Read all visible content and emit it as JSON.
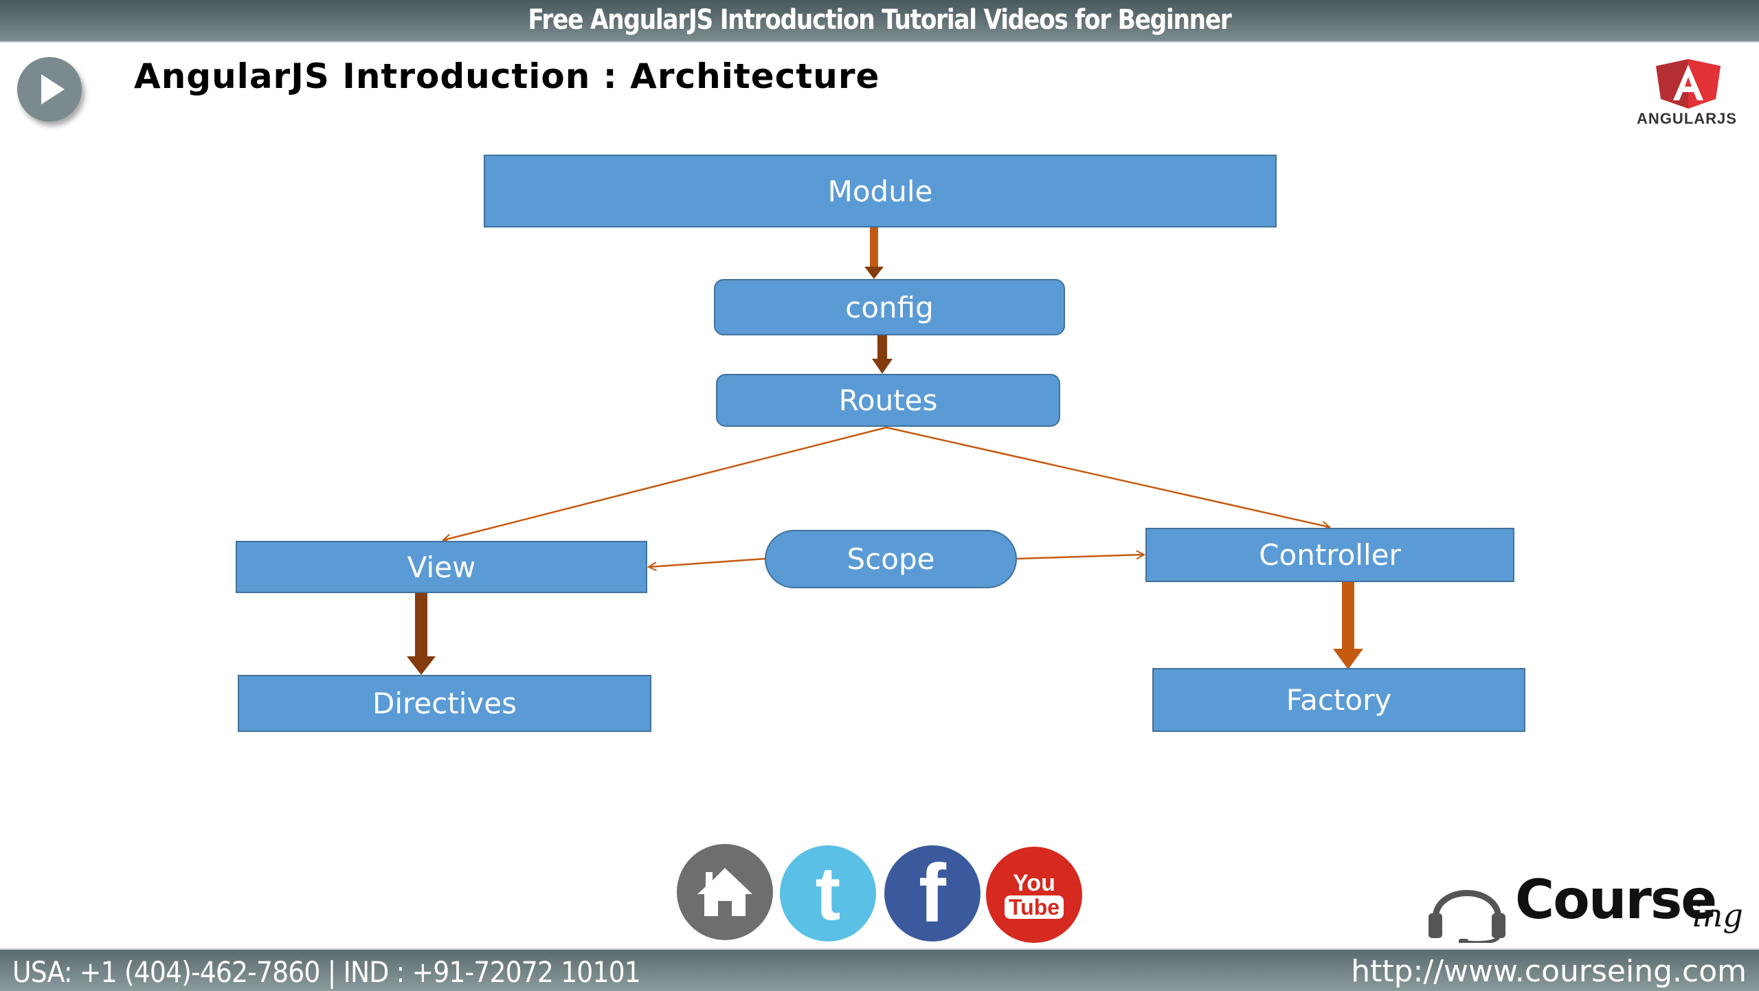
{
  "header": {
    "banner_title": "Free AngularJS Introduction Tutorial Videos for Beginner",
    "slide_title": "AngularJS Introduction : Architecture",
    "play_icon": "play-icon",
    "logo_text": "ANGULARJS",
    "logo_letter": "A"
  },
  "diagram": {
    "nodes": {
      "module": "Module",
      "config": "config",
      "routes": "Routes",
      "view": "View",
      "scope": "Scope",
      "controller": "Controller",
      "directives": "Directives",
      "factory": "Factory"
    },
    "edges": [
      {
        "from": "Module",
        "to": "config",
        "style": "thick"
      },
      {
        "from": "config",
        "to": "Routes",
        "style": "thick"
      },
      {
        "from": "Routes",
        "to": "View",
        "style": "thin"
      },
      {
        "from": "Routes",
        "to": "Controller",
        "style": "thin"
      },
      {
        "from": "Scope",
        "to": "View",
        "style": "thin"
      },
      {
        "from": "Scope",
        "to": "Controller",
        "style": "thin"
      },
      {
        "from": "View",
        "to": "Directives",
        "style": "thick"
      },
      {
        "from": "Controller",
        "to": "Factory",
        "style": "thick"
      }
    ],
    "colors": {
      "node_fill": "#5b9bd5",
      "node_border": "#41719c",
      "thick_arrow": "#843c0c",
      "thick_arrow_alt": "#c55a11",
      "thin_arrow": "#c55a11"
    }
  },
  "social": {
    "home_icon": "home-icon",
    "twitter_letter": "t",
    "facebook_letter": "f",
    "youtube_top": "You",
    "youtube_bottom": "Tube"
  },
  "brand": {
    "name": "Course",
    "suffix": "ing"
  },
  "footer": {
    "contact": "USA: +1 (404)-462-7860 | IND : +91-72072 10101",
    "url": "http://www.courseing.com"
  }
}
